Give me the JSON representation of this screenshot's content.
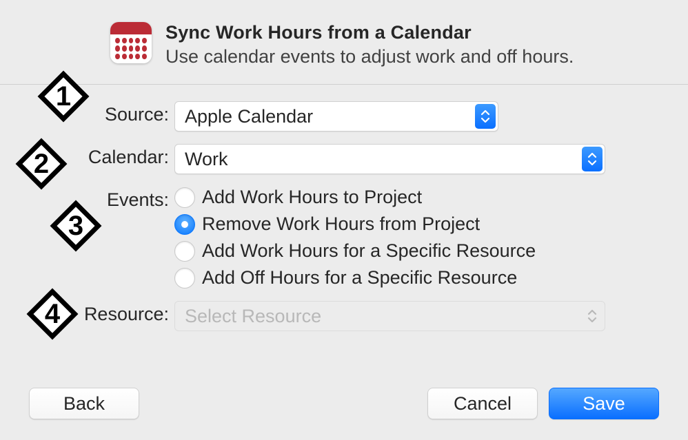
{
  "header": {
    "title": "Sync Work Hours from a Calendar",
    "subtitle": "Use calendar events to adjust work and off hours.",
    "icon": "calendar-icon"
  },
  "form": {
    "source": {
      "label": "Source:",
      "value": "Apple Calendar"
    },
    "calendar": {
      "label": "Calendar:",
      "value": "Work"
    },
    "events": {
      "label": "Events:",
      "options": [
        "Add Work Hours to Project",
        "Remove Work Hours from Project",
        "Add Work Hours for a Specific Resource",
        "Add Off Hours for a Specific Resource"
      ],
      "selected_index": 1
    },
    "resource": {
      "label": "Resource:",
      "placeholder": "Select Resource",
      "enabled": false
    }
  },
  "buttons": {
    "back": "Back",
    "cancel": "Cancel",
    "save": "Save"
  },
  "annotations": {
    "1": "1",
    "2": "2",
    "3": "3",
    "4": "4"
  },
  "colors": {
    "accent_blue": "#0a7bff",
    "icon_red": "#bb2c36"
  }
}
